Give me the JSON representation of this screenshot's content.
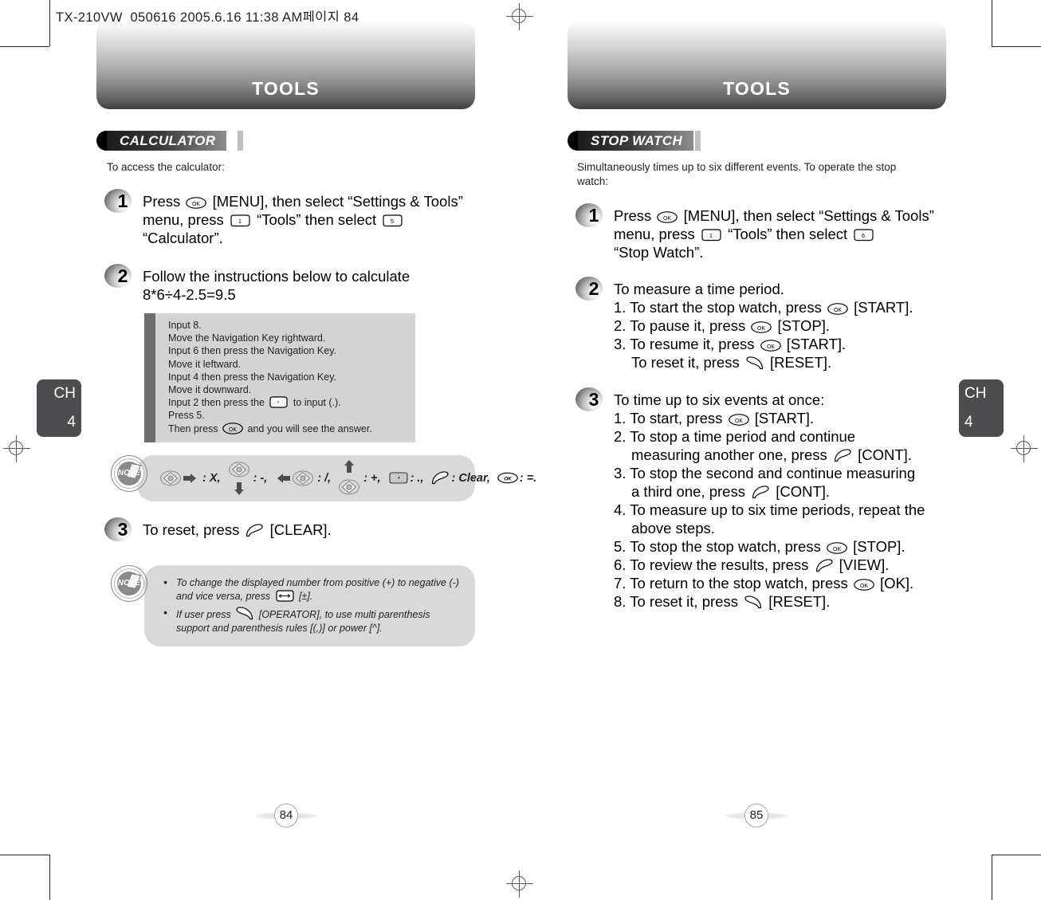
{
  "slug": "TX-210VW_050616  2005.6.16 11:38 AM페이지 84",
  "chapter_tab": {
    "letters": "CH",
    "number": "4"
  },
  "left_page": {
    "banner_title": "TOOLS",
    "section_title": "CALCULATOR",
    "intro": "To access the calculator:",
    "folio": "84",
    "steps": [
      {
        "number": "1",
        "lines": [
          "Press [key:ok] [MENU], then select “Settings & Tools”",
          "menu, press [key:num1] “Tools” then select [key:num5]",
          "“Calculator”."
        ]
      },
      {
        "number": "2",
        "lines": [
          "Follow the instructions below to calculate",
          "8*6÷4-2.5=9.5"
        ]
      },
      {
        "number": "3",
        "lines": [
          "To reset, press [key:clear] [CLEAR]."
        ]
      }
    ],
    "instruction_box": [
      "Input 8.",
      "Move the Navigation Key rightward.",
      "Input 6 then press the Navigation Key.",
      "Move it leftward.",
      "Input 4 then press the Navigation Key.",
      "Move it downward.",
      "Input 2 then press the [key:star] to input (.).",
      "Press 5.",
      "Then press [key:ok] and you will see the answer."
    ],
    "note_symbols": {
      "label": "NOTE",
      "items": [
        {
          "icon": "nav-right",
          "text": ": X,"
        },
        {
          "icon": "nav-down",
          "text": ": -,"
        },
        {
          "icon": "nav-left",
          "text": ": /,"
        },
        {
          "icon": "nav-up",
          "text": ": +,"
        },
        {
          "icon": "star-key",
          "text": ": .,"
        },
        {
          "icon": "clear-key",
          "text": ": Clear,"
        },
        {
          "icon": "ok-key",
          "text": ": =."
        }
      ]
    },
    "note_bullets": {
      "label": "NOTE",
      "items": [
        "To change the displayed number from positive (+) to negative (-) and vice versa, press [key:arrowkey] [±].",
        "If user press [key:operator] [OPERATOR], to use multi parenthesis support and parenthesis rules [(,)] or power [^]."
      ]
    }
  },
  "right_page": {
    "banner_title": "TOOLS",
    "section_title": "STOP WATCH",
    "intro": "Simultaneously times up to six different events. To operate the stop watch:",
    "folio": "85",
    "steps": [
      {
        "number": "1",
        "lines": [
          "Press [key:ok] [MENU], then select “Settings & Tools”",
          "menu, press [key:num1] “Tools” then select [key:num6]",
          "“Stop Watch”."
        ]
      },
      {
        "number": "2",
        "lines": [
          "To measure a time period.",
          "1. To start the stop watch, press [key:ok] [START].",
          "2. To pause it, press [key:ok] [STOP].",
          "3. To resume it, press [key:ok] [START].",
          "   To reset it, press [key:operator] [RESET]."
        ]
      },
      {
        "number": "3",
        "lines": [
          "To time up to six events at once:",
          "1. To start, press [key:ok] [START].",
          "2. To stop a time period and continue",
          "   measuring another one, press [key:clear] [CONT].",
          "3. To stop the second and continue measuring",
          "   a third one, press [key:clear] [CONT].",
          "4. To measure up to six time periods, repeat the",
          "   above steps.",
          "5. To stop the stop watch, press [key:ok] [STOP].",
          "6. To review the results, press [key:clear] [VIEW].",
          "7. To return to the stop watch, press [key:ok] [OK].",
          "8. To reset it, press [key:operator] [RESET]."
        ]
      }
    ]
  }
}
